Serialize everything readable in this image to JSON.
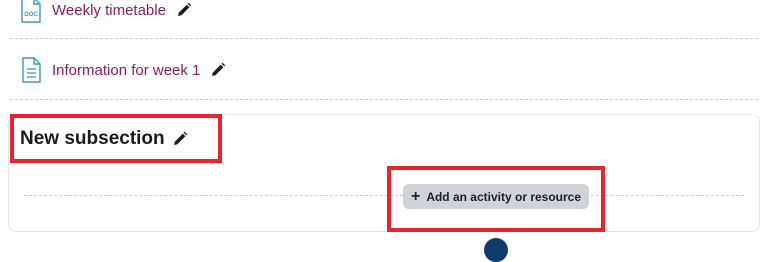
{
  "activities": [
    {
      "name": "Weekly timetable",
      "icon": "doc-file-icon"
    },
    {
      "name": "Information for week 1",
      "icon": "page-icon"
    }
  ],
  "subsection": {
    "title": "New subsection",
    "add_button_label": "Add an activity or resource"
  },
  "doc_icon_text": "DOC",
  "colors": {
    "activity_link": "#8a1f5a",
    "highlight": "#e8232b",
    "button_bg": "#ced4da",
    "icon_teal": "#3a9bb5"
  }
}
